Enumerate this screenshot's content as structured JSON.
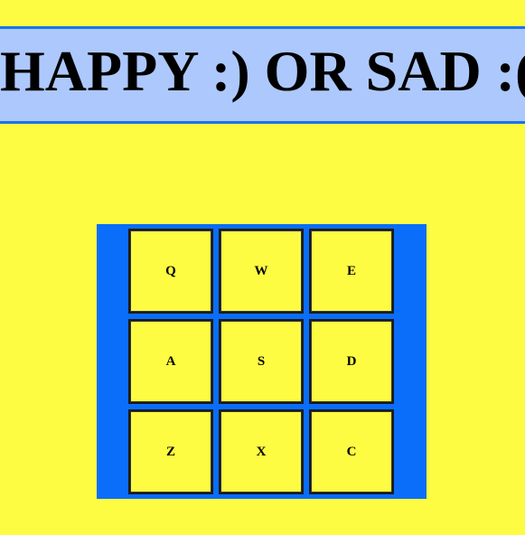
{
  "title": "HAPPY :) OR SAD :(",
  "colors": {
    "background": "#fefb43",
    "banner": "#adc8fc",
    "banner_border": "#1a73e8",
    "board": "#0a6efa",
    "key": "#fefb43"
  },
  "keys": [
    [
      "Q",
      "W",
      "E"
    ],
    [
      "A",
      "S",
      "D"
    ],
    [
      "Z",
      "X",
      "C"
    ]
  ]
}
